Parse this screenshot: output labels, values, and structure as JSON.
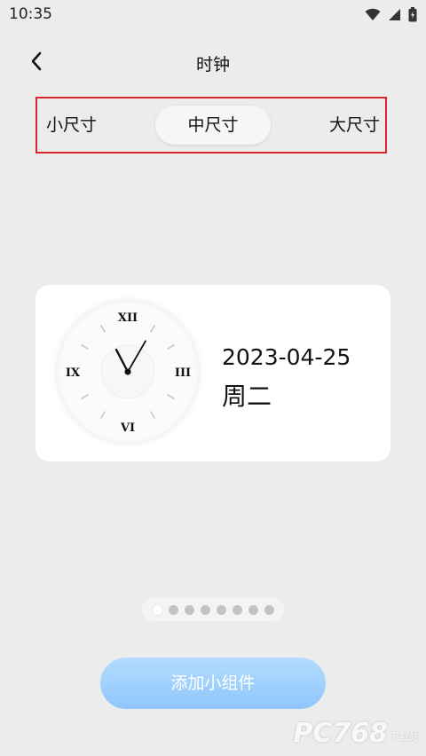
{
  "status_bar": {
    "time": "10:35",
    "icons": [
      "wifi-icon",
      "signal-icon",
      "battery-charging-icon"
    ]
  },
  "header": {
    "back_icon": "chevron-left-icon",
    "title": "时钟"
  },
  "size_tabs": {
    "items": [
      {
        "label": "小尺寸",
        "selected": false
      },
      {
        "label": "中尺寸",
        "selected": true
      },
      {
        "label": "大尺寸",
        "selected": false
      }
    ],
    "highlight_color": "#d9262b"
  },
  "widget_preview": {
    "clock": {
      "numerals": {
        "top": "XII",
        "right": "III",
        "bottom": "VI",
        "left": "IX"
      },
      "time_shown": "11:05"
    },
    "date": "2023-04-25",
    "weekday": "周二"
  },
  "pager": {
    "count": 8,
    "active_index": 0
  },
  "add_button": {
    "label": "添加小组件",
    "color": "#8fc6fb"
  },
  "watermark": {
    "text": "PC768",
    "subtext": "下载站"
  }
}
